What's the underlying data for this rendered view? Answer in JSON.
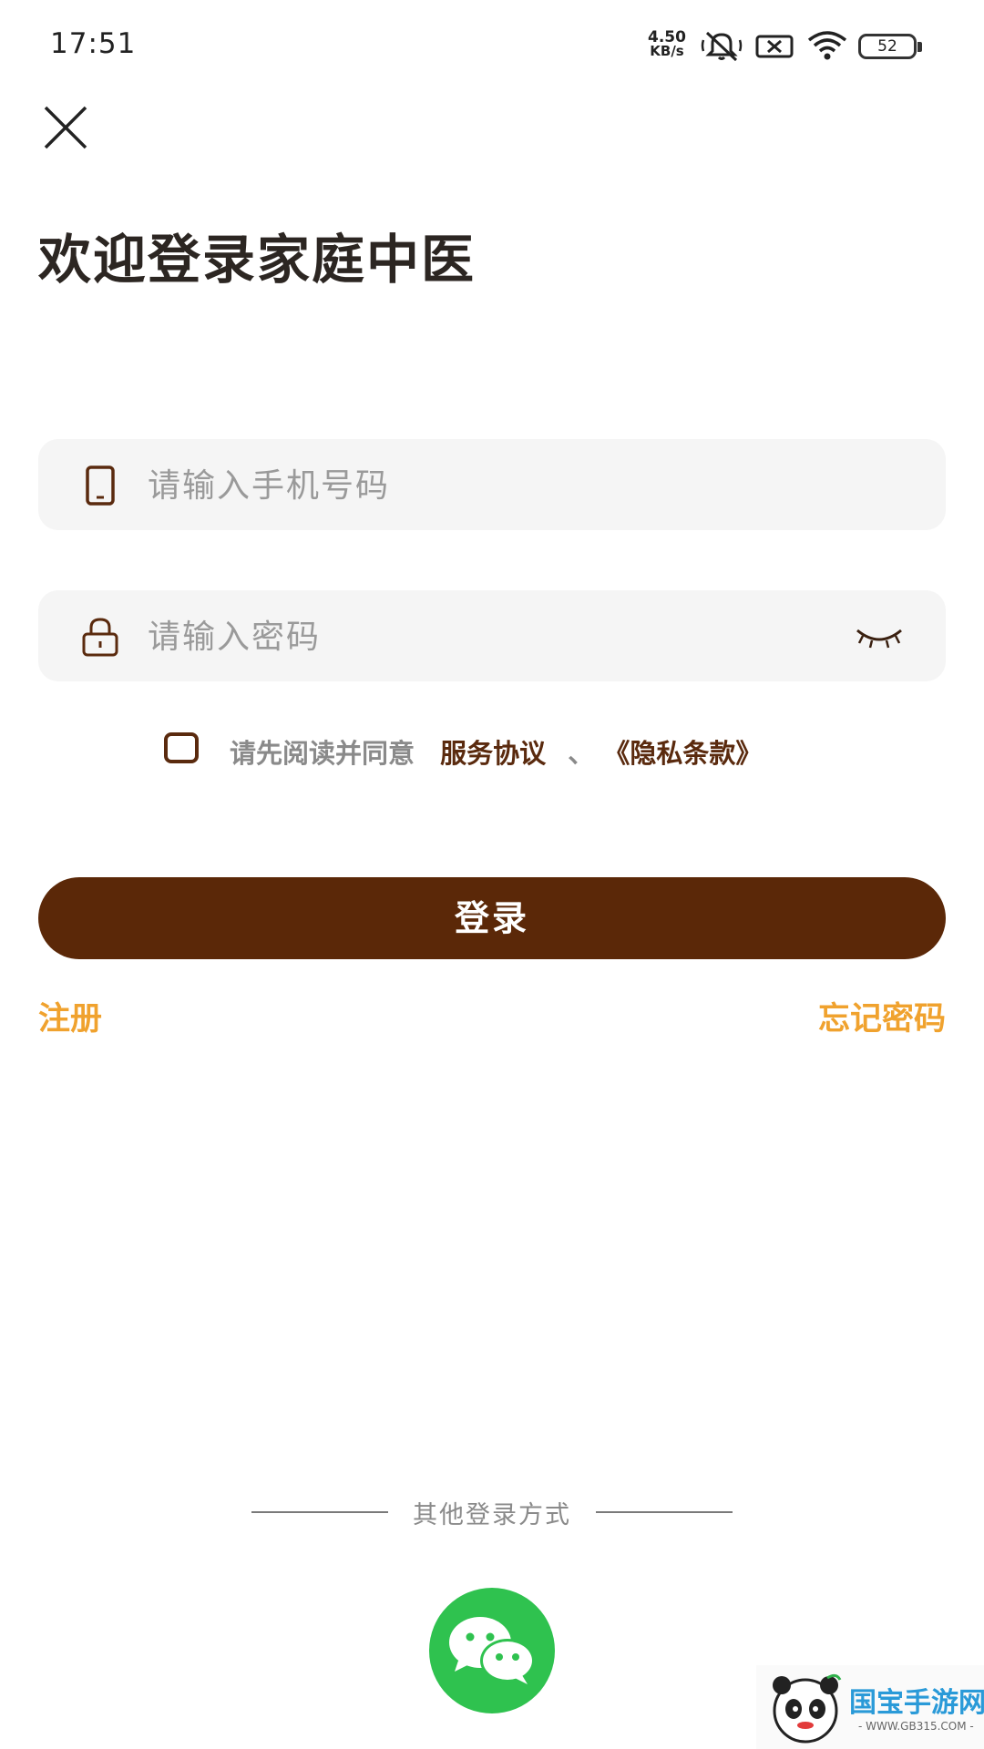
{
  "status_bar": {
    "time": "17:51",
    "net_speed_value": "4.50",
    "net_speed_unit": "KB/s",
    "battery": "52"
  },
  "header": {
    "title": "欢迎登录家庭中医"
  },
  "form": {
    "phone_placeholder": "请输入手机号码",
    "password_placeholder": "请输入密码"
  },
  "agreement": {
    "checked": false,
    "prefix": "请先阅读并同意",
    "terms_link": "服务协议",
    "separator": "、",
    "privacy_link": "《隐私条款》"
  },
  "actions": {
    "login_label": "登录",
    "register_label": "注册",
    "forgot_label": "忘记密码"
  },
  "other_login": {
    "label": "其他登录方式",
    "wechat_icon": "wechat-icon"
  },
  "watermark": {
    "text": "国宝手游网",
    "url": "- WWW.GB315.COM -"
  },
  "colors": {
    "primary_brown": "#5b2808",
    "accent_orange": "#f0a22e",
    "wechat_green": "#2fc24f",
    "input_bg": "#f5f5f5"
  }
}
